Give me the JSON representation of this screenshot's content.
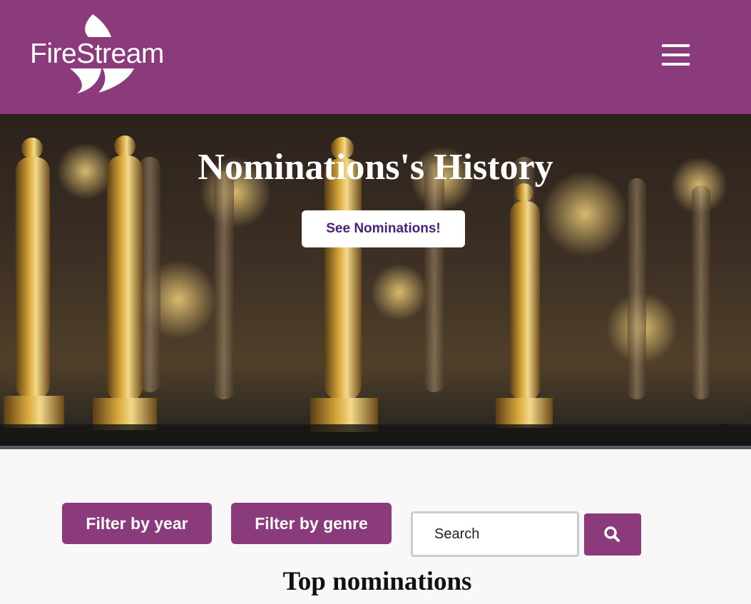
{
  "brand": {
    "name": "FireStream",
    "color": "#8b3a7c"
  },
  "header": {
    "menu_icon": "hamburger-menu-icon"
  },
  "hero": {
    "title": "Nominations's History",
    "button_label": "See Nominations!",
    "background": "golden-award-statuettes-photo"
  },
  "filters": {
    "year_label": "Filter by year",
    "genre_label": "Filter by genre"
  },
  "search": {
    "placeholder": "Search",
    "icon": "search-icon"
  },
  "section": {
    "title": "Top nominations"
  }
}
